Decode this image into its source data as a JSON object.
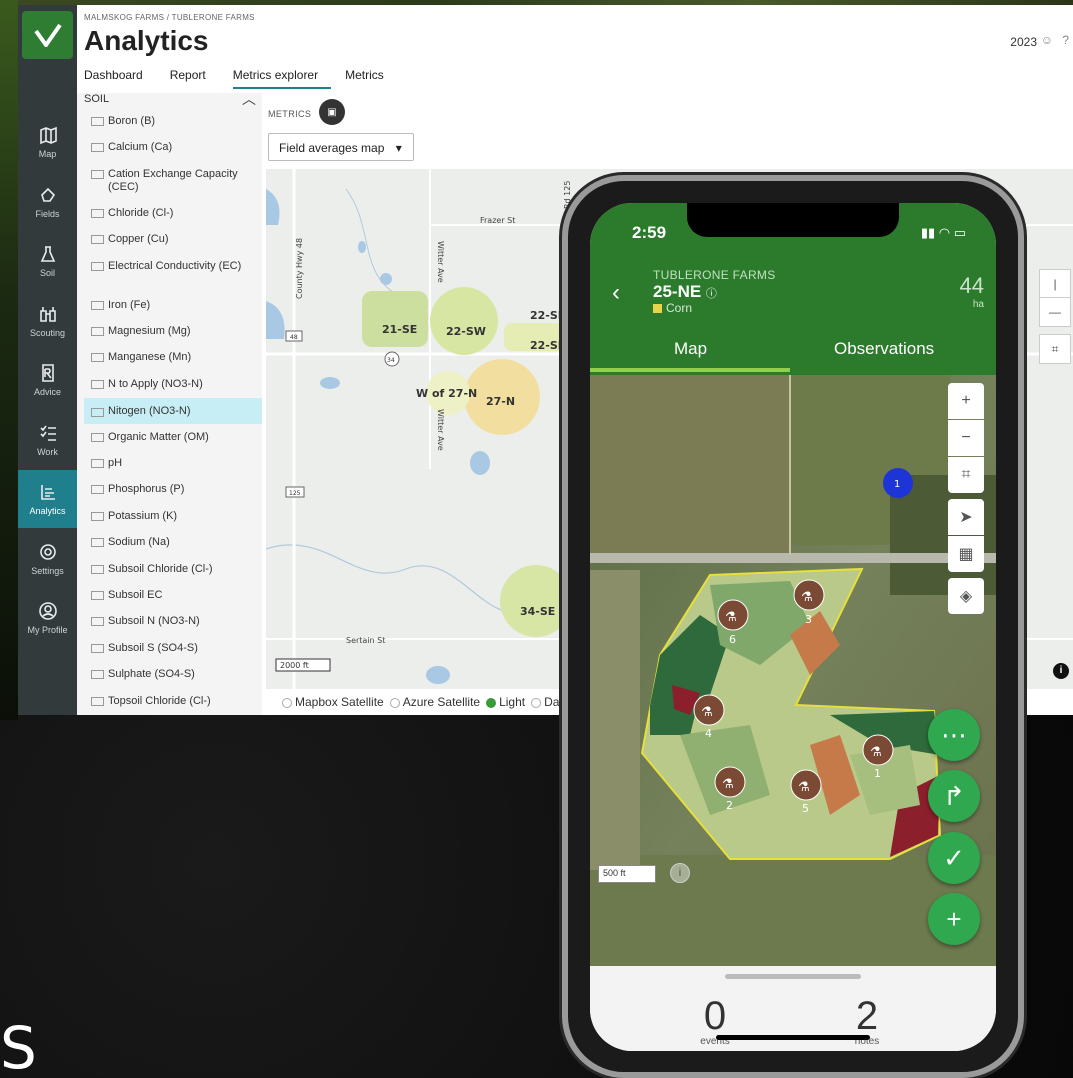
{
  "background": {
    "partial_word": "S"
  },
  "desktop": {
    "breadcrumb": "MALMSKOG FARMS / TUBLERONE FARMS",
    "title": "Analytics",
    "year": "2023",
    "tabs": [
      {
        "label": "Dashboard"
      },
      {
        "label": "Report"
      },
      {
        "label": "Metrics explorer",
        "active": true
      },
      {
        "label": "Metrics"
      }
    ],
    "nav": [
      {
        "label": "Map",
        "icon": "map-icon"
      },
      {
        "label": "Fields",
        "icon": "fields-icon"
      },
      {
        "label": "Soil",
        "icon": "flask-icon"
      },
      {
        "label": "Scouting",
        "icon": "binoculars-icon"
      },
      {
        "label": "Advice",
        "icon": "prescription-icon"
      },
      {
        "label": "Work",
        "icon": "checklist-icon"
      },
      {
        "label": "Analytics",
        "icon": "analytics-icon",
        "active": true
      },
      {
        "label": "Settings",
        "icon": "gear-icon"
      },
      {
        "label": "My Profile",
        "icon": "user-icon"
      }
    ],
    "list_header": "SOIL",
    "soil_items": [
      "Boron (B)",
      "Calcium (Ca)",
      "Cation Exchange Capacity (CEC)",
      "Chloride (Cl-)",
      "Copper (Cu)",
      "Electrical Conductivity (EC)",
      "Iron (Fe)",
      "Magnesium (Mg)",
      "Manganese (Mn)",
      "N to Apply (NO3-N)",
      "Nitogen (NO3-N)",
      "Organic Matter (OM)",
      "pH",
      "Phosphorus (P)",
      "Potassium (K)",
      "Sodium (Na)",
      "Subsoil Chloride (Cl-)",
      "Subsoil EC",
      "Subsoil N (NO3-N)",
      "Subsoil S (SO4-S)",
      "Sulphate (SO4-S)",
      "Topsoil Chloride (Cl-)"
    ],
    "selected_item": "Nitogen (NO3-N)",
    "metrics_label": "METRICS",
    "map_select": "Field averages map",
    "map_labels": {
      "roads": [
        "County Hwy 48",
        "Witter Ave",
        "Frazer St",
        "Witter Ave",
        "Sertain St",
        "Rd 125"
      ],
      "fields": [
        "21-SE",
        "22-SW",
        "22-SE",
        "22-SE",
        "W of 27-N",
        "27-N",
        "34-SE"
      ],
      "shields": [
        "48",
        "34",
        "125"
      ],
      "scale": "2000 ft"
    },
    "basemaps": [
      {
        "label": "Mapbox Satellite",
        "selected": false
      },
      {
        "label": "Azure Satellite",
        "selected": false
      },
      {
        "label": "Light",
        "selected": true
      },
      {
        "label": "Dar",
        "selected": false
      }
    ]
  },
  "phone": {
    "time": "2:59",
    "farm": "TUBLERONE FARMS",
    "field": "25-NE",
    "crop": "Corn",
    "area_value": "44",
    "area_unit": "ha",
    "tabs": [
      "Map",
      "Observations"
    ],
    "cluster_count": "1",
    "sample_points": [
      "6",
      "3",
      "4",
      "1",
      "2",
      "5"
    ],
    "scale": "500 ft",
    "info": "i",
    "events_count": "0",
    "events_label": "events",
    "notes_count": "2",
    "notes_label": "notes"
  }
}
